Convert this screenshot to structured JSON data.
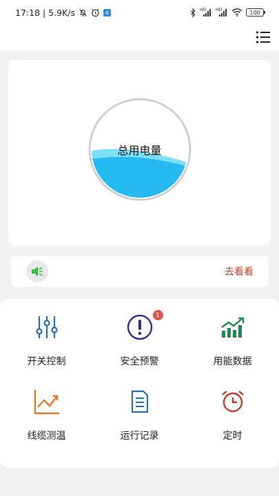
{
  "status_bar": {
    "time_speed": "17:18 | 5.9K/s",
    "app_icon": "e",
    "signal1_label": "HD",
    "signal2_label": "HD",
    "battery": "100"
  },
  "header": {
    "menu_icon": "list-menu-icon"
  },
  "power_card": {
    "label": "总用电量",
    "fill_level": 0.38
  },
  "notice": {
    "icon": "speaker-icon",
    "link_label": "去看看"
  },
  "features": [
    {
      "label": "开关控制",
      "icon": "switch-sliders-icon",
      "color": "#2a6db5"
    },
    {
      "label": "安全预警",
      "icon": "alert-icon",
      "color": "#3b2a8f",
      "badge": "1"
    },
    {
      "label": "用能数据",
      "icon": "growth-chart-icon",
      "color": "#1e8a4a"
    },
    {
      "label": "线缆测温",
      "icon": "line-chart-icon",
      "color": "#e07a2a"
    },
    {
      "label": "运行记录",
      "icon": "document-icon",
      "color": "#2a6db5"
    },
    {
      "label": "定时",
      "icon": "alarm-clock-icon",
      "color": "#c0392b"
    }
  ]
}
